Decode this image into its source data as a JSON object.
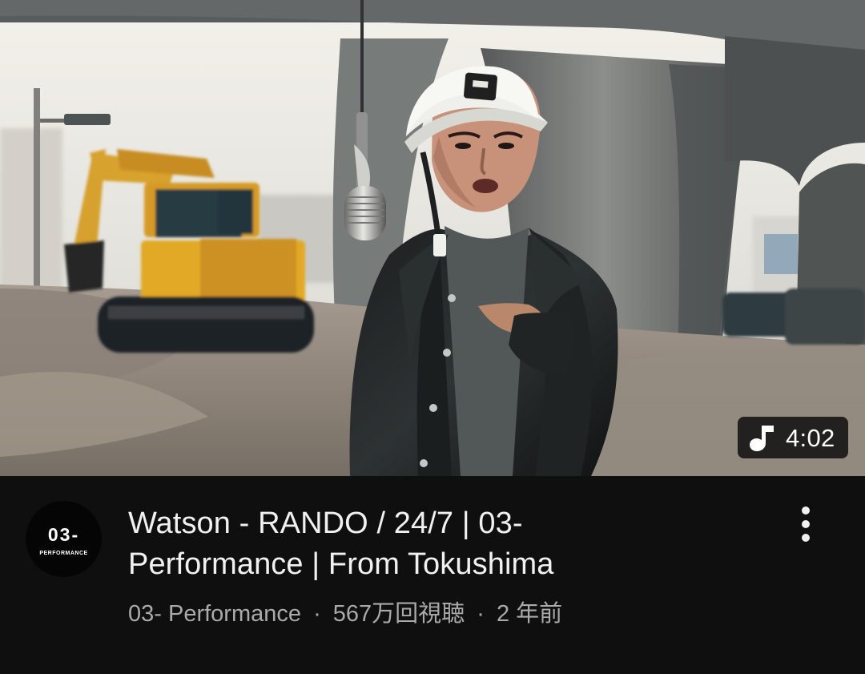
{
  "video": {
    "thumbnail_icon": "music-note-icon",
    "duration": "4:02",
    "title": "Watson - RANDO / 24/7 | 03-\nPerformance | From Tokushima",
    "channel": "03- Performance",
    "views": "567万回視聴",
    "age": "2 年前",
    "separator": "·"
  },
  "channel_avatar": {
    "main_text": "03-",
    "sub_text": "PERFORMANCE"
  },
  "menu": {
    "icon": "vertical-dots-icon"
  },
  "colors": {
    "background": "#0f0f0f",
    "primary_text": "#f1f1f1",
    "secondary_text": "#aaaaaa",
    "badge_background": "#0a0a0a"
  }
}
